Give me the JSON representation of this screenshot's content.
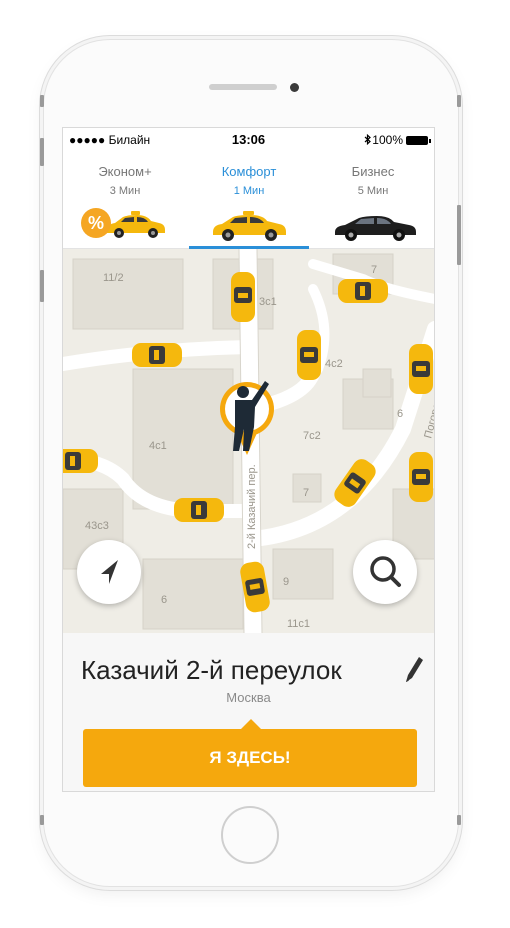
{
  "status_bar": {
    "carrier": "●●●●● Билайн",
    "time": "13:06",
    "battery": "100%",
    "bluetooth_icon": "bluetooth-icon"
  },
  "tariffs": [
    {
      "name": "Эконом+",
      "eta": "3 Мин",
      "badge": "%"
    },
    {
      "name": "Комфорт",
      "eta": "1 Мин",
      "active": true
    },
    {
      "name": "Бизнес",
      "eta": "5 Мин"
    }
  ],
  "map": {
    "labels": [
      "11/2",
      "7",
      "3c1",
      "4c2",
      "4c1",
      "7c2",
      "6",
      "7",
      "43c3",
      "9",
      "6",
      "11c1"
    ],
    "street_labels": [
      "2-й Казачий пер.",
      "Погорельский пер."
    ]
  },
  "buttons": {
    "locate_icon": "navigation-arrow-icon",
    "search_icon": "search-icon"
  },
  "address": {
    "street": "Казачий 2-й переулок",
    "city": "Москва"
  },
  "cta": {
    "label": "Я ЗДЕСЬ!"
  },
  "colors": {
    "accent": "#f5a80d",
    "tab_active": "#2a8fd8",
    "taxi": "#f5b80d"
  }
}
